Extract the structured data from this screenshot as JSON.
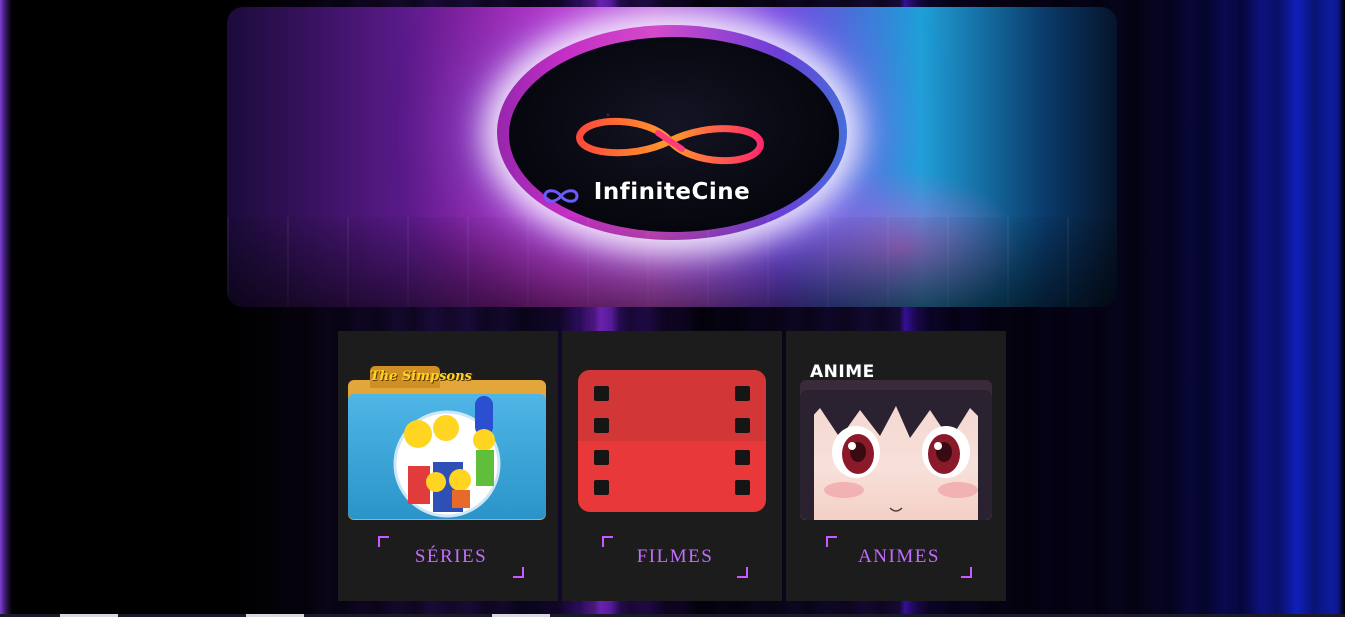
{
  "banner": {
    "brand_name": "InfiniteCine",
    "logo_icon": "infinity-logo-icon"
  },
  "cards": [
    {
      "label": "SÉRIES",
      "icon": "simpsons-folder-icon",
      "folder_title": "The Simpsons"
    },
    {
      "label": "FILMES",
      "icon": "film-strip-icon"
    },
    {
      "label": "ANIMES",
      "icon": "anime-folder-icon",
      "folder_title": "ANIME"
    }
  ],
  "colors": {
    "card_bg": "#1c1c1c",
    "label_color": "#c56bff",
    "corner_color": "#c85bff",
    "film_red": "#e8383a"
  }
}
